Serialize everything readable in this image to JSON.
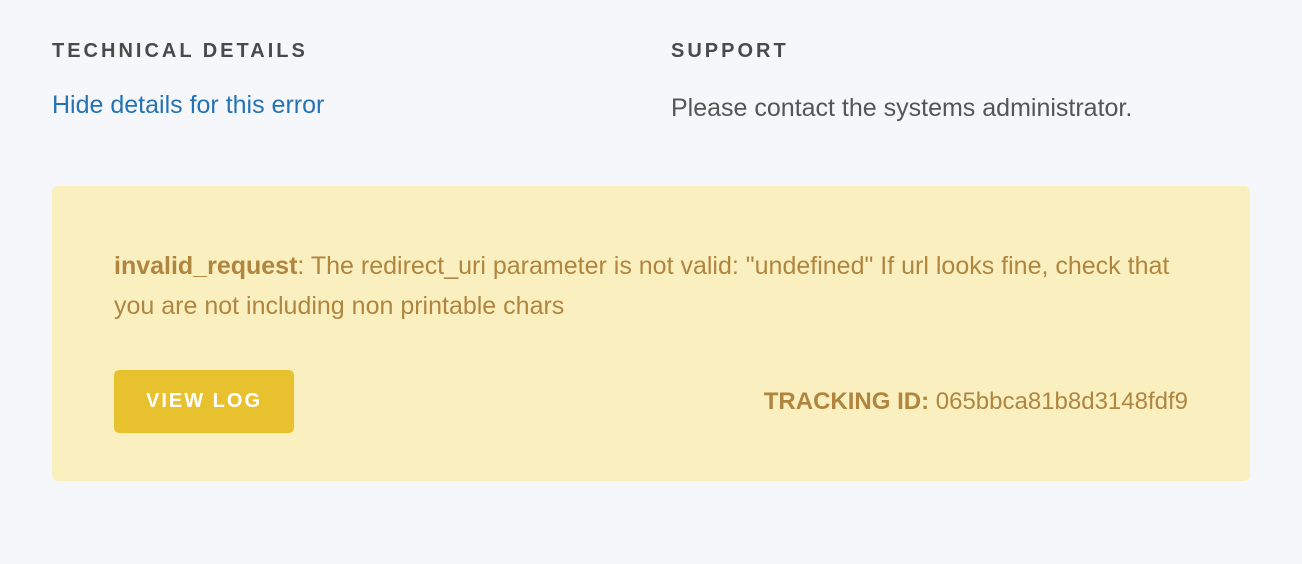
{
  "technical": {
    "heading": "TECHNICAL DETAILS",
    "toggle_link": "Hide details for this error"
  },
  "support": {
    "heading": "SUPPORT",
    "message": "Please contact the systems administrator."
  },
  "error": {
    "code": "invalid_request",
    "separator": ": ",
    "description": "The redirect_uri parameter is not valid: \"undefined\" If url looks fine, check that you are not including non printable chars",
    "view_log_label": "VIEW LOG",
    "tracking_label": "TRACKING ID: ",
    "tracking_id": "065bbca81b8d3148fdf9"
  }
}
